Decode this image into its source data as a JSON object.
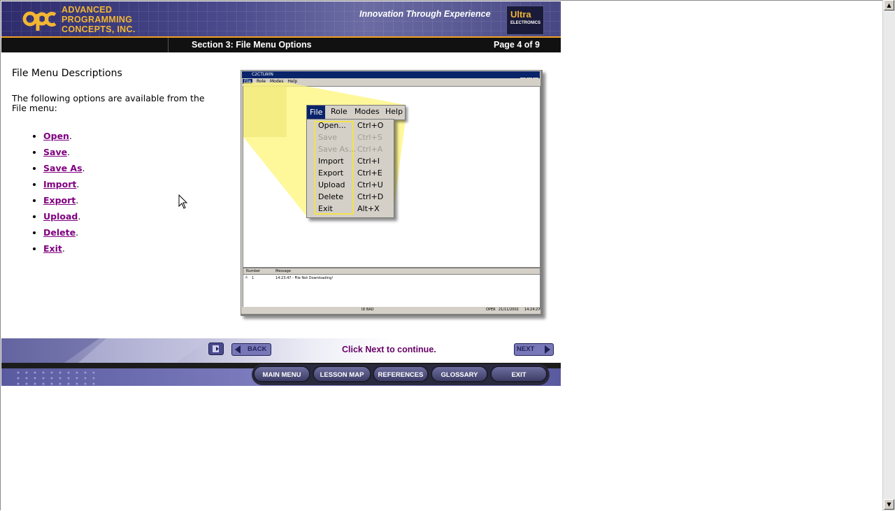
{
  "header": {
    "company_line1": "ADVANCED",
    "company_line2": "PROGRAMMING",
    "company_line3": "CONCEPTS, INC.",
    "tagline": "Innovation Through Experience",
    "partner_logo_main": "Ultra",
    "partner_logo_sub": "ELECTRONICS"
  },
  "titlebar": {
    "section": "Section 3: File Menu Options",
    "page": "Page 4 of 9"
  },
  "content": {
    "heading": "File Menu Descriptions",
    "intro": "The following options are available from the File menu:",
    "options": [
      "Open",
      "Save",
      "Save As",
      "Import",
      "Export",
      "Upload",
      "Delete",
      "Exit"
    ]
  },
  "screenshot": {
    "window_title": "C2CTLWIN",
    "menubar": [
      "File",
      "Role",
      "Modes",
      "Help"
    ],
    "menu_items": [
      {
        "label": "Open...",
        "shortcut": "Ctrl+O",
        "enabled": true
      },
      {
        "label": "Save",
        "shortcut": "Ctrl+S",
        "enabled": false
      },
      {
        "label": "Save As...",
        "shortcut": "Ctrl+A",
        "enabled": false
      },
      {
        "label": "Import",
        "shortcut": "Ctrl+I",
        "enabled": true
      },
      {
        "label": "Export",
        "shortcut": "Ctrl+E",
        "enabled": true
      },
      {
        "label": "Upload",
        "shortcut": "Ctrl+U",
        "enabled": true
      },
      {
        "label": "Delete",
        "shortcut": "Ctrl+D",
        "enabled": true
      },
      {
        "label": "Exit",
        "shortcut": "Alt+X",
        "enabled": true
      }
    ],
    "msg_header_number": "Number",
    "msg_header_message": "Message",
    "msg_row_number": "1",
    "msg_row_text": "14:23:47 - File Not Downloading!",
    "status_id": "ID BAD",
    "status_mode": "OPER",
    "status_date": "21/11/2002",
    "status_time": "14:24:27"
  },
  "nav": {
    "back_label": "BACK",
    "continue_text": "Click Next to continue.",
    "next_label": "NEXT"
  },
  "bottom_menu": {
    "main_menu": "MAIN MENU",
    "lesson_map": "LESSON MAP",
    "references": "REFERENCES",
    "glossary": "GLOSSARY",
    "exit": "EXIT"
  },
  "colors": {
    "header_blue": "#3b3a7a",
    "accent_orange": "#f2a023",
    "link_purple": "#800080",
    "continue_text": "#660066",
    "highlight_yellow": "#fff57a"
  }
}
